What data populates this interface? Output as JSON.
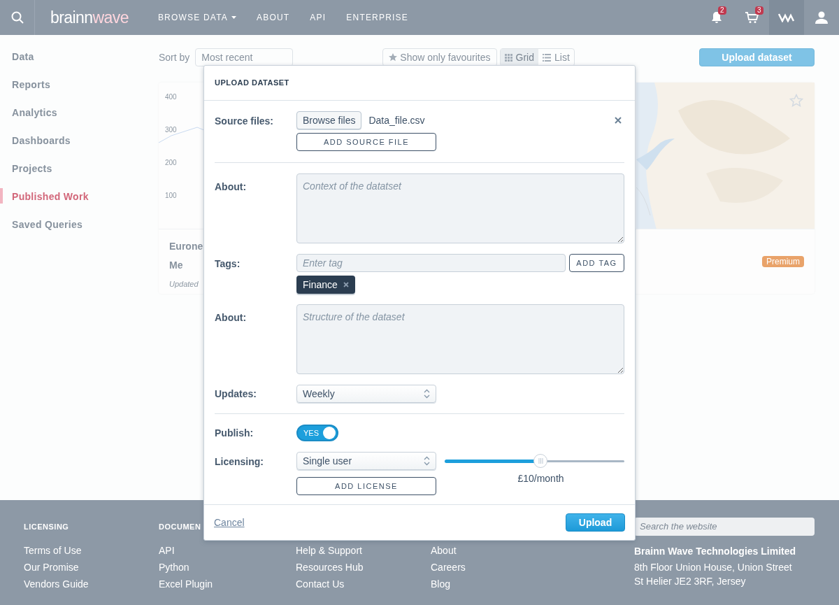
{
  "header": {
    "logo": {
      "part_1": "brainn",
      "part_2": "wave"
    },
    "nav": [
      {
        "label": "BROWSE DATA",
        "dropdown": true
      },
      {
        "label": "ABOUT",
        "dropdown": false
      },
      {
        "label": "API",
        "dropdown": false
      },
      {
        "label": "ENTERPRISE",
        "dropdown": false
      }
    ],
    "notifications_badge": "2",
    "cart_badge": "3"
  },
  "sidebar": {
    "items": [
      {
        "label": "Data",
        "selected": false
      },
      {
        "label": "Reports",
        "selected": false
      },
      {
        "label": "Analytics",
        "selected": false
      },
      {
        "label": "Dashboards",
        "selected": false
      },
      {
        "label": "Projects",
        "selected": false
      },
      {
        "label": "Published Work",
        "selected": true
      },
      {
        "label": "Saved Queries",
        "selected": false
      }
    ]
  },
  "toolbar": {
    "sort_label": "Sort by",
    "sort_value": "Most recent",
    "favourites": "Show only favourites",
    "views": [
      {
        "label": "Grid",
        "selected": true
      },
      {
        "label": "List",
        "selected": false
      }
    ],
    "upload": "Upload dataset"
  },
  "cards": [
    {
      "kind": "chart",
      "axis_labels": [
        "400",
        "300",
        "200",
        "100"
      ],
      "title": "Eurone",
      "subtitle": "Me",
      "updated": "Updated"
    },
    {
      "kind": "map",
      "badge": "Premium"
    }
  ],
  "modal": {
    "title": "UPLOAD DATASET",
    "source_files": {
      "label": "Source files:",
      "browse_button": "Browse files",
      "file_name": "Data_file.csv",
      "add_button": "ADD SOURCE FILE"
    },
    "context": {
      "label": "About:",
      "placeholder": "Context of the datatset"
    },
    "tags": {
      "label": "Tags:",
      "placeholder": "Enter tag",
      "add_button": "ADD TAG",
      "items": [
        {
          "label": "Finance"
        }
      ]
    },
    "structure": {
      "label": "About:",
      "placeholder": "Structure of the dataset"
    },
    "updates": {
      "label": "Updates:",
      "value": "Weekly"
    },
    "publish": {
      "label": "Publish:",
      "on": true,
      "text": "YES"
    },
    "licensing": {
      "label": "Licensing:",
      "value": "Single user",
      "add_button": "ADD LICENSE",
      "level": 0.535,
      "reading": "£10/month"
    },
    "cancel": "Cancel",
    "upload": "Upload"
  },
  "footer": {
    "columns": [
      {
        "heading": "LICENSING",
        "links": [
          "Terms of Use",
          "Our Promise",
          "Vendors Guide"
        ]
      },
      {
        "heading": "DOCUMEN",
        "links": [
          "API",
          "Python",
          "Excel Plugin"
        ]
      },
      {
        "links": [
          "Help & Support",
          "Resources Hub",
          "Contact Us"
        ]
      },
      {
        "links": [
          "About",
          "Careers",
          "Blog"
        ]
      }
    ],
    "search_placeholder": "Search the website",
    "company": "Brainn Wave Technologies Limited",
    "address": [
      "8th Floor Union House, Union Street",
      "St Helier JE2 3RF, Jersey"
    ]
  }
}
